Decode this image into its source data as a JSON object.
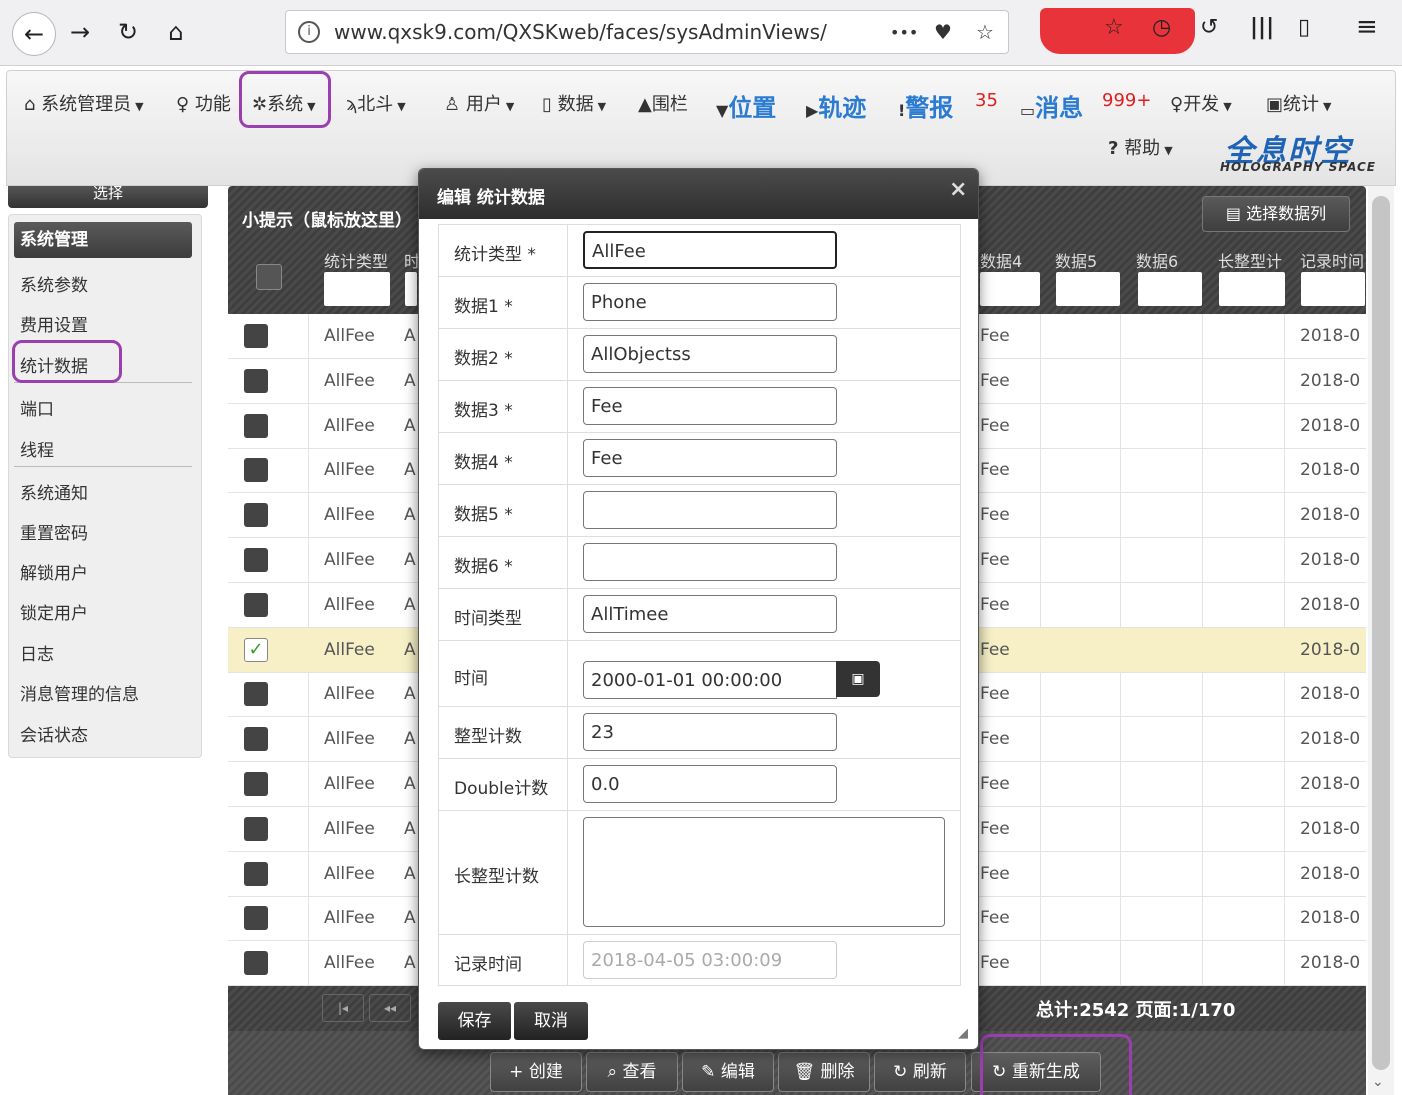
{
  "browser": {
    "url": "www.qxsk9.com/QXSKweb/faces/sysAdminViews/",
    "back_icon": "←",
    "forward_icon": "→",
    "reload_icon": "↻",
    "home_icon": "⌂",
    "info_icon": "i",
    "more_icon": "•••",
    "pocket_icon": "♥",
    "bookmark_icon": "☆",
    "ext_icon": "☆",
    "clock_icon": "◷",
    "history_icon": "↺",
    "library_icon": "|||",
    "sidebar_icon": "▯",
    "menu_icon": "≡"
  },
  "nav": {
    "admin": "系统管理员",
    "feature": "功能",
    "system": "系统",
    "beidou": "北斗",
    "user": "用户",
    "data": "数据",
    "fence": "围栏",
    "location": "位置",
    "track": "轨迹",
    "alarm": "警报",
    "alarm_count": "35",
    "message": "消息",
    "message_count": "999+",
    "dev": "开发",
    "stats": "统计",
    "help": "帮助",
    "logo_text": "全息时空",
    "logo_sub": "HOLOGRAPHY SPACE"
  },
  "sidebar": {
    "top_label": "选择",
    "header": "系统管理",
    "items": [
      "系统参数",
      "费用设置",
      "统计数据",
      "端口",
      "线程",
      "系统通知",
      "重置密码",
      "解锁用户",
      "锁定用户",
      "日志",
      "消息管理的信息",
      "会话状态"
    ]
  },
  "grid": {
    "title": "小提示（鼠标放这里）",
    "select_cols": "选择数据列",
    "col_type": "统计类型",
    "col_time": "时",
    "col_d4": "数据4",
    "col_d5": "数据5",
    "col_d6": "数据6",
    "col_long": "长整型计",
    "col_rec": "记录时间",
    "rows": [
      {
        "type": "AllFee",
        "a": "A",
        "d4": "Fee",
        "rec": "2018-0"
      },
      {
        "type": "AllFee",
        "a": "A",
        "d4": "Fee",
        "rec": "2018-0"
      },
      {
        "type": "AllFee",
        "a": "A",
        "d4": "Fee",
        "rec": "2018-0"
      },
      {
        "type": "AllFee",
        "a": "A",
        "d4": "Fee",
        "rec": "2018-0"
      },
      {
        "type": "AllFee",
        "a": "A",
        "d4": "Fee",
        "rec": "2018-0"
      },
      {
        "type": "AllFee",
        "a": "A",
        "d4": "Fee",
        "rec": "2018-0"
      },
      {
        "type": "AllFee",
        "a": "A",
        "d4": "Fee",
        "rec": "2018-0"
      },
      {
        "type": "AllFee",
        "a": "A",
        "d4": "Fee",
        "rec": "2018-0",
        "selected": true
      },
      {
        "type": "AllFee",
        "a": "A",
        "d4": "Fee",
        "rec": "2018-0"
      },
      {
        "type": "AllFee",
        "a": "A",
        "d4": "Fee",
        "rec": "2018-0"
      },
      {
        "type": "AllFee",
        "a": "A",
        "d4": "Fee",
        "rec": "2018-0"
      },
      {
        "type": "AllFee",
        "a": "A",
        "d4": "Fee",
        "rec": "2018-0"
      },
      {
        "type": "AllFee",
        "a": "A",
        "d4": "Fee",
        "rec": "2018-0"
      },
      {
        "type": "AllFee",
        "a": "A",
        "d4": "Fee",
        "rec": "2018-0"
      },
      {
        "type": "AllFee",
        "a": "A",
        "d4": "Fee",
        "rec": "2018-0"
      }
    ],
    "total": "总计:2542 页面:1/170",
    "first_icon": "|◂",
    "prev_icon": "◂◂"
  },
  "toolbar": {
    "create": "+ 创建",
    "view": "⌕ 查看",
    "edit": "✎ 编辑",
    "delete": "🗑 删除",
    "refresh": "↻ 刷新",
    "regen": "↻ 重新生成"
  },
  "dialog": {
    "title": "编辑 统计数据",
    "close": "×",
    "labels": {
      "stat_type": "统计类型 *",
      "d1": "数据1 *",
      "d2": "数据2 *",
      "d3": "数据3 *",
      "d4": "数据4 *",
      "d5": "数据5 *",
      "d6": "数据6 *",
      "time_type": "时间类型",
      "time": "时间",
      "int_count": "整型计数",
      "double_count": "Double计数",
      "long_count": "长整型计数",
      "record_time": "记录时间"
    },
    "values": {
      "stat_type": "AllFee",
      "d1": "Phone",
      "d2": "AllObjectss",
      "d3": "Fee",
      "d4": "Fee",
      "d5": "",
      "d6": "",
      "time_type": "AllTimee",
      "time": "2000-01-01 00:00:00",
      "int_count": "23",
      "double_count": "0.0",
      "long_count": "",
      "record_time": "2018-04-05 03:00:09"
    },
    "calendar_icon": "▣",
    "save": "保存",
    "cancel": "取消"
  }
}
